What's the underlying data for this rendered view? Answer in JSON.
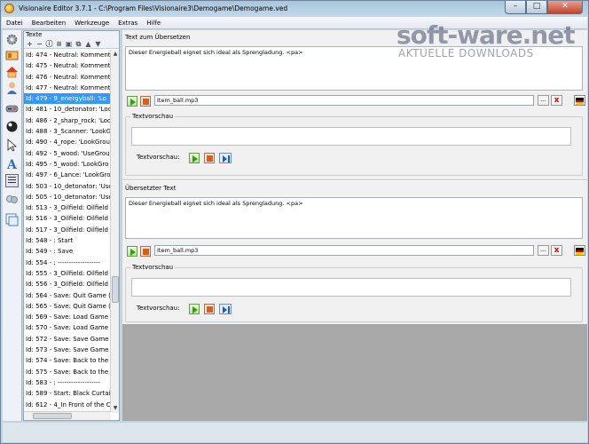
{
  "window": {
    "title": "Visionaire Editor 3.7.1 - C:\\Program Files\\Visionaire3\\Demogame\\Demogame.ved",
    "min": "–",
    "max": "□",
    "close": "✕"
  },
  "menu": [
    "Datei",
    "Bearbeiten",
    "Werkzeuge",
    "Extras",
    "Hilfe"
  ],
  "left_pane": {
    "header": "Texte",
    "items": [
      "Id: 474 - Neutral: Komment",
      "Id: 475 - Neutral: Komment",
      "Id: 476 - Neutral: Komment",
      "Id: 477 - Neutral: Komment",
      "Id: 479 - 9_energyball: 'Lo",
      "Id: 481 - 10_detonator: 'Loo",
      "Id: 486 - 2_sharp_rock: 'Loo",
      "Id: 488 - 3_Scanner: 'LookG",
      "Id: 490 - 4_rope: 'LookGrou",
      "Id: 492 - 5_wood: 'UseGrou",
      "Id: 495 - 5_wood: 'LookGro",
      "Id: 497 - 6_Lance: 'LookGro",
      "Id: 503 - 10_detonator: 'Use",
      "Id: 505 - 10_detonator: 'Use",
      "Id: 513 - 3_Oilfield: Oilfield",
      "Id: 516 - 3_Oilfield: Oilfield",
      "Id: 517 - 3_Oilfield: Oilfield",
      "Id: 548 - : Start",
      "Id: 549 - : Save",
      "Id: 554 - : -------------------",
      "Id: 555 - 3_Oilfield: Oilfield",
      "Id: 556 - 3_Oilfield: Oilfield",
      "Id: 564 - Save: Quit Game (",
      "Id: 565 - Save: Quit Game (",
      "Id: 569 - Save: Load Game (",
      "Id: 570 - Save: Load Game (",
      "Id: 572 - Save: Save Game (",
      "Id: 573 - Save: Save Game (",
      "Id: 574 - Save: Back to the G",
      "Id: 575 - Save: Back to the G",
      "Id: 583 - : -------------------",
      "Id: 589 - Start: Black Curtai",
      "Id: 612 - 4_In Front of the C"
    ],
    "selected_index": 4
  },
  "source": {
    "label": "Text zum Übersetzen",
    "text": "Dieser Energieball eignet sich ideal als Sprengladung. <pa>",
    "audio_file": "Item_ball.mp3",
    "preview_group": "Textvorschau",
    "preview_label": "Textvorschau:"
  },
  "translated": {
    "label": "Übersetzter Text",
    "text": "Dieser Energieball eignet sich ideal als Sprengladung. <pa>",
    "audio_file": "Item_ball.mp3",
    "preview_group": "Textvorschau",
    "preview_label": "Textvorschau:"
  },
  "browse_label": "...",
  "delete_label": "x",
  "flag_colors": [
    "#000000",
    "#dd0000",
    "#ffcc00"
  ],
  "watermark": {
    "line1": "soft-ware.net",
    "line2": "AKTUELLE DOWNLOADS"
  }
}
